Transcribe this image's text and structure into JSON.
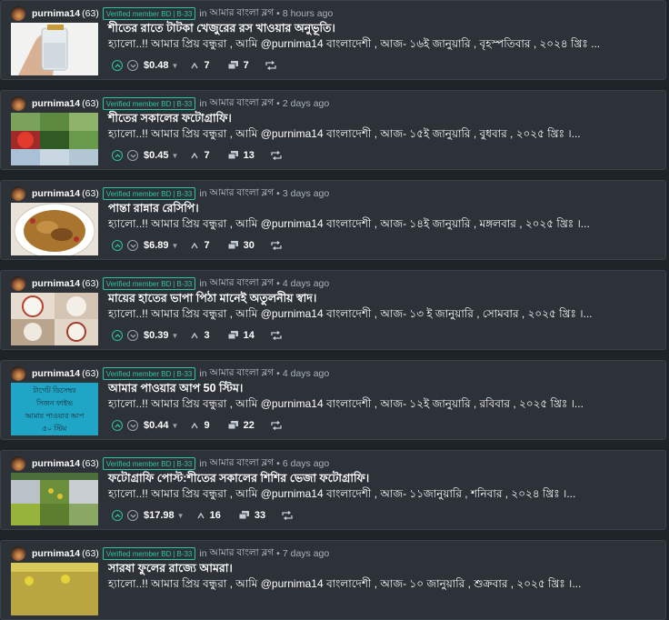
{
  "posts": [
    {
      "author": "purnima14",
      "reputation": "(63)",
      "badge": "Verified member",
      "badge_role": "BD",
      "badge_group": "B-33",
      "in_label": "in",
      "community": "আমার বাংলা ব্লগ",
      "time": "8 hours ago",
      "title": "শীতের রাতে টাটকা খেজুরের রস খাওয়ার অনুভূতি।",
      "summary": "হ্যালো..!! আমার প্রিয় বন্ধুরা , আমি @purnima14 বাংলাদেশী , আজ- ১৬ই জানুয়ারি , বৃহস্পতিবার , ২০২৪ খ্রিঃ ...",
      "payout": "$0.48",
      "votes": "7",
      "comments": "7"
    },
    {
      "author": "purnima14",
      "reputation": "(63)",
      "badge": "Verified member",
      "badge_role": "BD",
      "badge_group": "B-33",
      "in_label": "in",
      "community": "আমার বাংলা ব্লগ",
      "time": "2 days ago",
      "title": "শীতের সকালের ফটোগ্রাফি।",
      "summary": "হ্যালো..!! আমার প্রিয় বন্ধুরা , আমি @purnima14 বাংলাদেশী , আজ- ১৫ই জানুয়ারি , বুধবার , ২০২৫ খ্রিঃ ।...",
      "payout": "$0.45",
      "votes": "7",
      "comments": "13"
    },
    {
      "author": "purnima14",
      "reputation": "(63)",
      "badge": "Verified member",
      "badge_role": "BD",
      "badge_group": "B-33",
      "in_label": "in",
      "community": "আমার বাংলা ব্লগ",
      "time": "3 days ago",
      "title": "পান্তা রান্নার রেসিপি।",
      "summary": "হ্যালো..!! আমার প্রিয় বন্ধুরা , আমি @purnima14 বাংলাদেশী , আজ- ১৪ই জানুয়ারি , মঙ্গলবার , ২০২৫ খ্রিঃ ।...",
      "payout": "$6.89",
      "votes": "7",
      "comments": "30"
    },
    {
      "author": "purnima14",
      "reputation": "(63)",
      "badge": "Verified member",
      "badge_role": "BD",
      "badge_group": "B-33",
      "in_label": "in",
      "community": "আমার বাংলা ব্লগ",
      "time": "4 days ago",
      "title": "মায়ের হাতের ভাপা পিঠা মানেই অতুলনীয় স্বাদ।",
      "summary": "হ্যালো..!! আমার প্রিয় বন্ধুরা , আমি @purnima14 বাংলাদেশী , আজ- ১৩ ই জানুয়ারি , সোমবার , ২০২৫ খ্রিঃ ।...",
      "payout": "$0.39",
      "votes": "3",
      "comments": "14"
    },
    {
      "author": "purnima14",
      "reputation": "(63)",
      "badge": "Verified member",
      "badge_role": "BD",
      "badge_group": "B-33",
      "in_label": "in",
      "community": "আমার বাংলা ব্লগ",
      "time": "4 days ago",
      "title": "আমার পাওয়ার আপ 50 স্টিম।",
      "summary": "হ্যালো..!! আমার প্রিয় বন্ধুরা , আমি @purnima14 বাংলাদেশী , আজ- ১২ই জানুয়ারি , রবিবার , ২০২৫ খ্রিঃ ।...",
      "payout": "$0.44",
      "votes": "9",
      "comments": "22",
      "thumb_text": [
        "টার্গেট ডিসেম্বর",
        "সিজন ফাইভ",
        "আমার পাওয়ার আপ",
        "৫০ স্টিম"
      ]
    },
    {
      "author": "purnima14",
      "reputation": "(63)",
      "badge": "Verified member",
      "badge_role": "BD",
      "badge_group": "B-33",
      "in_label": "in",
      "community": "আমার বাংলা ব্লগ",
      "time": "6 days ago",
      "title": "ফটোগ্রাফি পোস্ট:শীতের সকালের শিশির ভেজা ফটোগ্রাফি।",
      "summary": "হ্যালো..!! আমার প্রিয় বন্ধুরা , আমি @purnima14 বাংলাদেশী , আজ- ১১জানুয়ারি , শনিবার , ২০২৪ খ্রিঃ ।...",
      "payout": "$17.98",
      "votes": "16",
      "comments": "33"
    },
    {
      "author": "purnima14",
      "reputation": "(63)",
      "badge": "Verified member",
      "badge_role": "BD",
      "badge_group": "B-33",
      "in_label": "in",
      "community": "আমার বাংলা ব্লগ",
      "time": "7 days ago",
      "title": "সারষা ফুলের রাজ্যে আমরা।",
      "summary": "হ্যালো..!! আমার প্রিয় বন্ধুরা , আমি @purnima14 বাংলাদেশী , আজ- ১০ জানুয়ারি , শুক্রবার , ২০২৫ খ্রিঃ ।...",
      "payout": "",
      "votes": "",
      "comments": ""
    }
  ],
  "icons": {
    "upvote": "chevron-up-circle-icon",
    "downvote": "chevron-down-circle-icon",
    "votes": "chevron-up-icon",
    "comments": "comments-icon",
    "reblog": "reblog-icon"
  },
  "colors": {
    "page_bg": "#1e2328",
    "card_bg": "#2c3238",
    "accent": "#2ec4a0"
  }
}
